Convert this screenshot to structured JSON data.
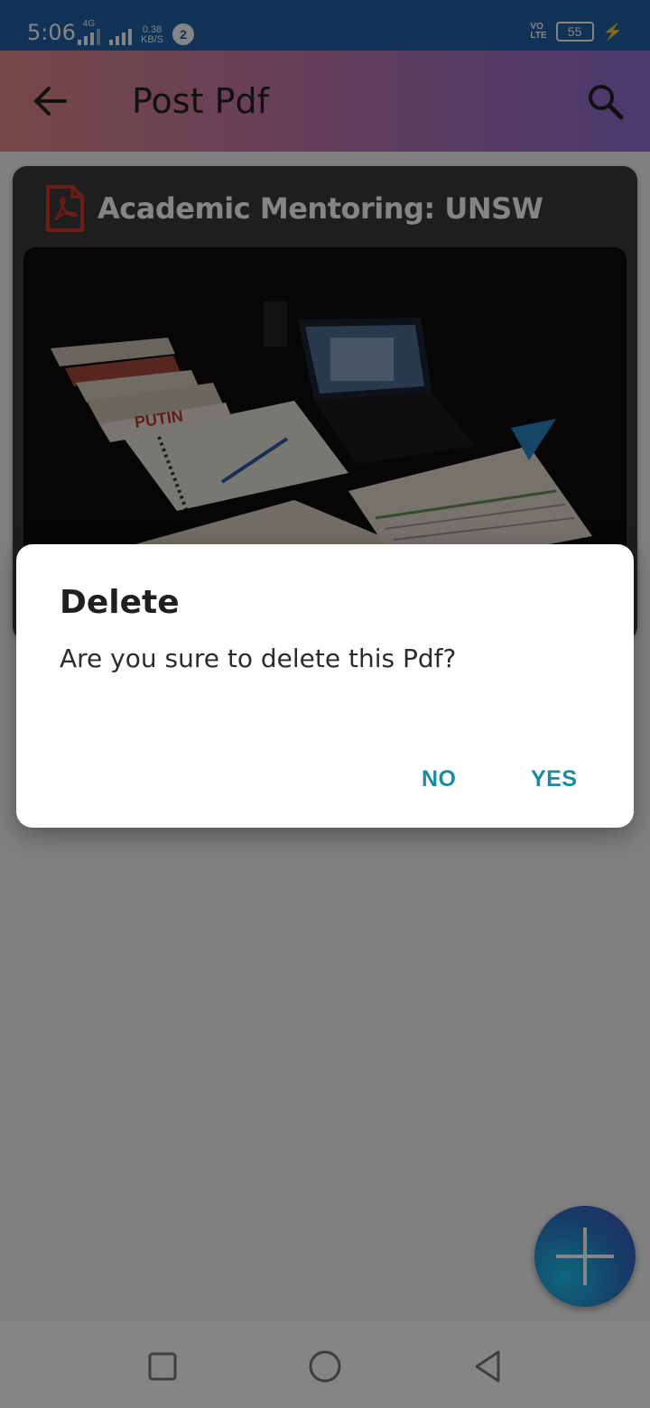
{
  "status_bar": {
    "time": "5:06",
    "network_type": "4G",
    "net_speed_value": "0.38",
    "net_speed_unit": "KB/S",
    "notification_count": "2",
    "volte_top": "VO",
    "volte_bottom": "LTE",
    "battery_level": "55"
  },
  "toolbar": {
    "title": "Post Pdf",
    "back_icon": "arrow-back-icon",
    "search_icon": "search-icon"
  },
  "card": {
    "title": "Academic Mentoring: UNSW",
    "icon": "pdf-icon",
    "image_label": "PUTIN"
  },
  "dialog": {
    "title": "Delete",
    "message": "Are you sure to delete this Pdf?",
    "no_label": "NO",
    "yes_label": "YES"
  },
  "fab": {
    "icon": "plus-icon"
  },
  "nav_bar": {
    "icons": [
      "recent-apps-icon",
      "home-icon",
      "back-icon"
    ]
  },
  "colors": {
    "status_bar": "#1f62a8",
    "toolbar_gradient_start": "#e38b8b",
    "toolbar_gradient_end": "#8c6dd3",
    "dialog_button": "#1b8aa6",
    "pdf_red": "#d9342b"
  }
}
